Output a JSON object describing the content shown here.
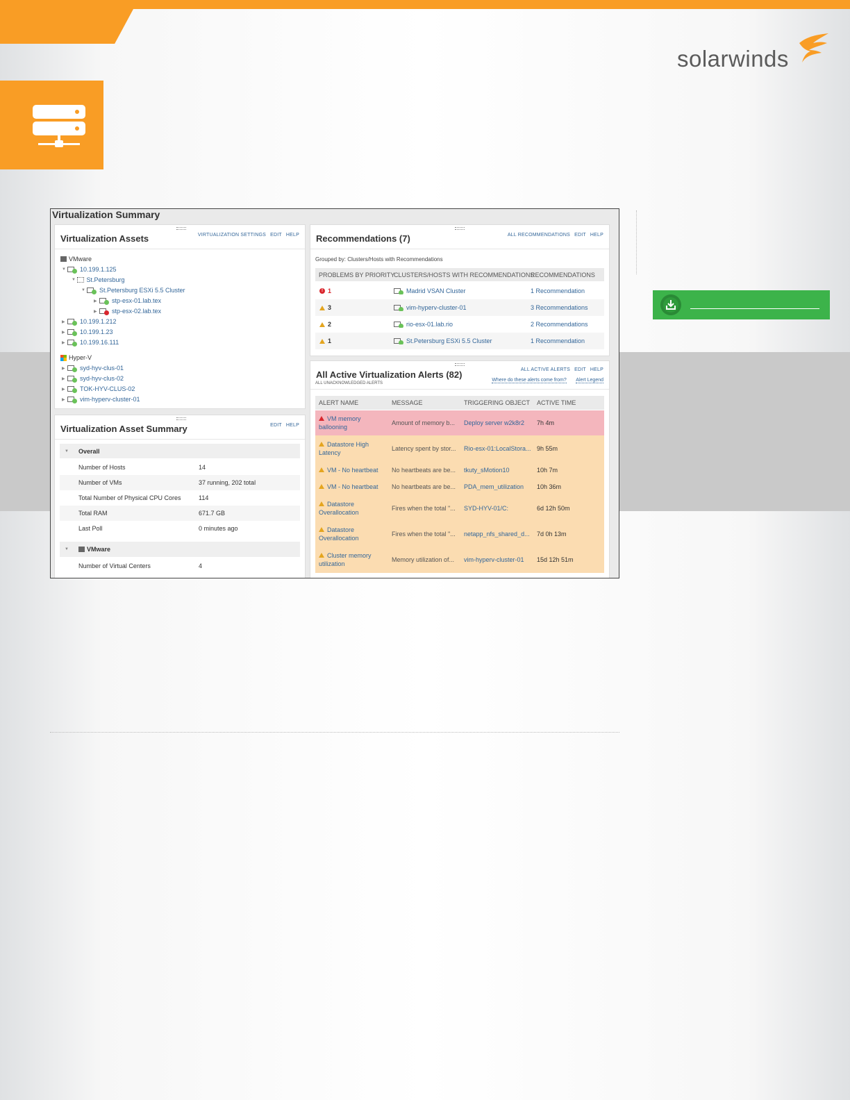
{
  "brand": {
    "logo_text": "solarwinds",
    "accent": "#f99d25",
    "green": "#3cb34a"
  },
  "screenshot": {
    "title": "Virtualization Summary",
    "assets_panel": {
      "title": "Virtualization Assets",
      "links": [
        "VIRTUALIZATION SETTINGS",
        "EDIT",
        "HELP"
      ],
      "tree": [
        {
          "label": "VMware",
          "level": 0,
          "icon": "vmware-icon",
          "status": "none"
        },
        {
          "label": "10.199.1.125",
          "level": 1,
          "status": "up"
        },
        {
          "label": "St.Petersburg",
          "level": 2,
          "status": "none"
        },
        {
          "label": "St.Petersburg ESXi 5.5 Cluster",
          "level": 3,
          "status": "up"
        },
        {
          "label": "stp-esx-01.lab.tex",
          "level": 4,
          "status": "up"
        },
        {
          "label": "stp-esx-02.lab.tex",
          "level": 4,
          "status": "down"
        },
        {
          "label": "10.199.1.212",
          "level": 1,
          "status": "up"
        },
        {
          "label": "10.199.1.23",
          "level": 1,
          "status": "up"
        },
        {
          "label": "10.199.16.111",
          "level": 1,
          "status": "up"
        },
        {
          "label": "Hyper-V",
          "level": 0,
          "icon": "windows-icon",
          "status": "none"
        },
        {
          "label": "syd-hyv-clus-01",
          "level": 1,
          "status": "up"
        },
        {
          "label": "syd-hyv-clus-02",
          "level": 1,
          "status": "up"
        },
        {
          "label": "TOK-HYV-CLUS-02",
          "level": 1,
          "status": "up"
        },
        {
          "label": "vim-hyperv-cluster-01",
          "level": 1,
          "status": "up"
        }
      ]
    },
    "asset_summary_panel": {
      "title": "Virtualization Asset Summary",
      "links": [
        "EDIT",
        "HELP"
      ],
      "overall_label": "Overall",
      "rows": [
        {
          "label": "Number of Hosts",
          "value": "14"
        },
        {
          "label": "Number of VMs",
          "value": "37 running, 202 total"
        },
        {
          "label": "Total Number of Physical CPU Cores",
          "value": "114"
        },
        {
          "label": "Total RAM",
          "value": "671.7 GB"
        },
        {
          "label": "Last Poll",
          "value": "0 minutes ago"
        }
      ],
      "vmware_label": "VMware",
      "vmware_rows": [
        {
          "label": "Number of Virtual Centers",
          "value": "4"
        }
      ]
    },
    "recommendations_panel": {
      "title": "Recommendations (7)",
      "links": [
        "ALL RECOMMENDATIONS",
        "EDIT",
        "HELP"
      ],
      "grouped_by": "Grouped by: Clusters/Hosts with Recommendations",
      "columns": [
        "PROBLEMS BY PRIORITY",
        "CLUSTERS/HOSTS WITH RECOMMENDATIONS",
        "RECOMMENDATIONS"
      ],
      "rows": [
        {
          "priority": "critical",
          "count": "1",
          "object": "Madrid VSAN Cluster",
          "recs": "1 Recommendation"
        },
        {
          "priority": "warning",
          "count": "3",
          "object": "vim-hyperv-cluster-01",
          "recs": "3 Recommendations"
        },
        {
          "priority": "warning",
          "count": "2",
          "object": "rio-esx-01.lab.rio",
          "recs": "2 Recommendations"
        },
        {
          "priority": "warning",
          "count": "1",
          "object": "St.Petersburg ESXi 5.5 Cluster",
          "recs": "1 Recommendation"
        }
      ]
    },
    "alerts_panel": {
      "title": "All Active Virtualization Alerts (82)",
      "subtitle": "ALL UNACKNOWLEDGED ALERTS",
      "links": [
        "ALL ACTIVE ALERTS",
        "EDIT",
        "HELP"
      ],
      "where_link": "Where do these alerts come from?",
      "legend_link": "Alert Legend",
      "columns": [
        "ALERT NAME",
        "MESSAGE",
        "TRIGGERING OBJECT",
        "ACTIVE TIME"
      ],
      "rows": [
        {
          "severity": "critical",
          "name": "VM memory ballooning",
          "message": "Amount of memory b...",
          "object": "Deploy server w2k8r2",
          "time": "7h 4m"
        },
        {
          "severity": "warning",
          "name": "Datastore High Latency",
          "message": "Latency spent by stor...",
          "object": "Rio-esx-01:LocalStora...",
          "time": "9h 55m"
        },
        {
          "severity": "warning",
          "name": "VM - No heartbeat",
          "message": "No heartbeats are be...",
          "object": "tkuty_sMotion10",
          "time": "10h 7m"
        },
        {
          "severity": "warning",
          "name": "VM - No heartbeat",
          "message": "No heartbeats are be...",
          "object": "PDA_mem_utilization",
          "time": "10h 36m"
        },
        {
          "severity": "warning",
          "name": "Datastore Overallocation",
          "message": "Fires when the total \"...",
          "object": "SYD-HYV-01/C:",
          "time": "6d 12h 50m"
        },
        {
          "severity": "warning",
          "name": "Datastore Overallocation",
          "message": "Fires when the total \"...",
          "object": "netapp_nfs_shared_d...",
          "time": "7d 0h 13m"
        },
        {
          "severity": "warning",
          "name": "Cluster memory utilization",
          "message": "Memory utilization of...",
          "object": "vim-hyperv-cluster-01",
          "time": "15d 12h 51m"
        }
      ],
      "colors": {
        "critical": "#f4b6bd",
        "warning": "#fbdcb1"
      }
    }
  }
}
